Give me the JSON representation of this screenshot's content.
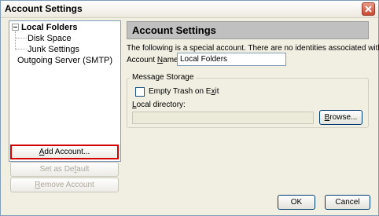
{
  "window": {
    "title": "Account Settings"
  },
  "tree": {
    "root": "Local Folders",
    "children": [
      "Disk Space",
      "Junk Settings"
    ],
    "smtp": "Outgoing Server (SMTP)"
  },
  "left_buttons": {
    "add": {
      "pre": "",
      "u": "A",
      "post": "dd Account..."
    },
    "set_default": {
      "pre": "Set as De",
      "u": "f",
      "post": "ault"
    },
    "remove": {
      "pre": "",
      "u": "R",
      "post": "emove Account"
    }
  },
  "main": {
    "header": "Account Settings",
    "info": "The following is a special account. There are no identities associated with it.",
    "account_name_label": {
      "pre": "Account ",
      "u": "N",
      "post": "ame:"
    },
    "account_name_value": "Local Folders",
    "storage_legend": "Message Storage",
    "empty_trash": {
      "pre": "Empty Trash on E",
      "u": "x",
      "post": "it"
    },
    "local_dir_label": {
      "pre": "",
      "u": "L",
      "post": "ocal directory:"
    },
    "local_dir_value": "",
    "browse": {
      "pre": "",
      "u": "B",
      "post": "rowse..."
    }
  },
  "dialog_buttons": {
    "ok": "OK",
    "cancel": "Cancel"
  },
  "colors": {
    "highlight": "#d40000",
    "header_bg": "#c0c0c0",
    "window_bg": "#f1efe2"
  }
}
